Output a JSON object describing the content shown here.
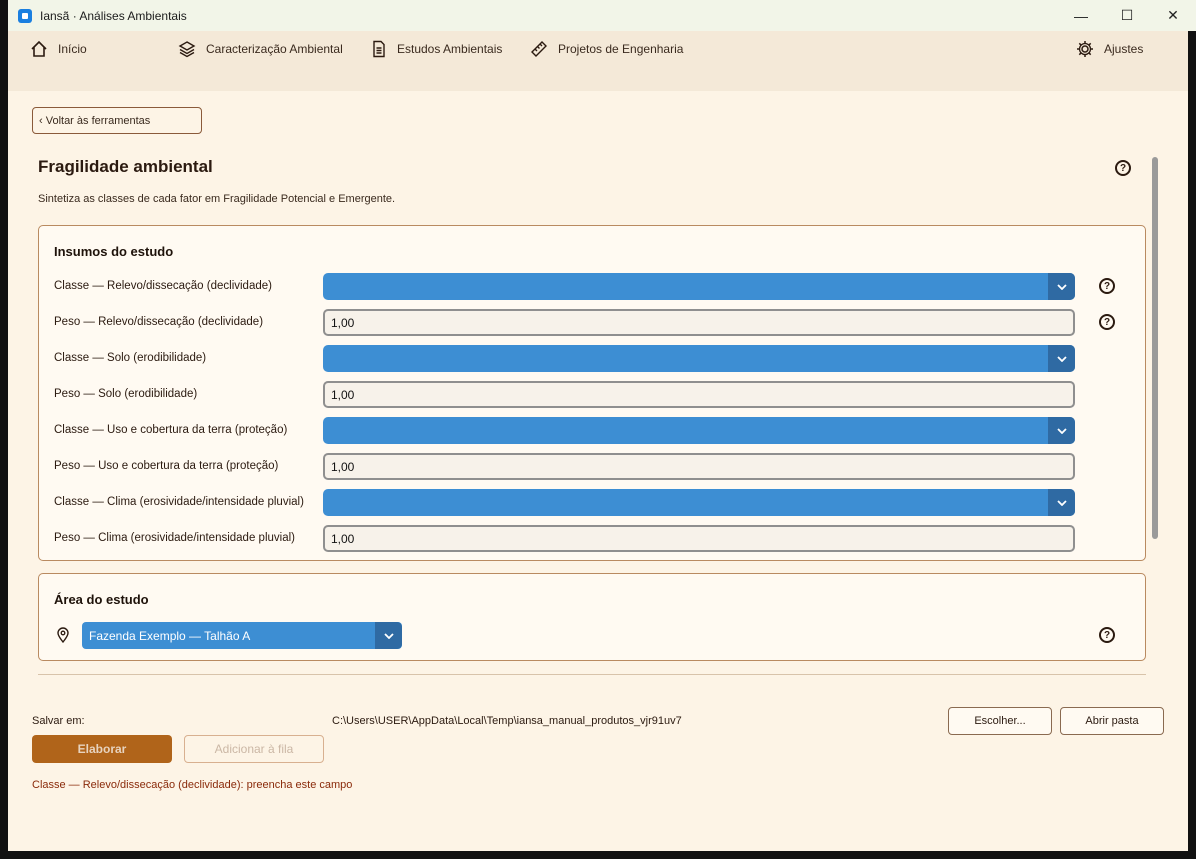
{
  "window": {
    "title": "Iansã · Análises Ambientais",
    "minimize": "—",
    "maximize": "☐",
    "close": "✕"
  },
  "nav": {
    "home": "Início",
    "characterization": "Caracterização Ambiental",
    "studies": "Estudos Ambientais",
    "engineering": "Projetos de Engenharia",
    "settings": "Ajustes"
  },
  "back_button": "‹ Voltar às ferramentas",
  "page": {
    "title": "Fragilidade ambiental",
    "subtitle": "Sintetiza as classes de cada fator em Fragilidade Potencial e Emergente.",
    "help": "?"
  },
  "inputs_card": {
    "title": "Insumos do estudo",
    "rows": [
      {
        "label": "Classe — Relevo/dissecação (declividade)",
        "type": "dropdown",
        "value": ""
      },
      {
        "label": "Peso — Relevo/dissecação (declividade)",
        "type": "text",
        "value": "1,00"
      },
      {
        "label": "Classe — Solo (erodibilidade)",
        "type": "dropdown",
        "value": ""
      },
      {
        "label": "Peso — Solo (erodibilidade)",
        "type": "text",
        "value": "1,00"
      },
      {
        "label": "Classe — Uso e cobertura da terra (proteção)",
        "type": "dropdown",
        "value": ""
      },
      {
        "label": "Peso — Uso e cobertura da terra (proteção)",
        "type": "text",
        "value": "1,00"
      },
      {
        "label": "Classe — Clima (erosividade/intensidade pluvial)",
        "type": "dropdown",
        "value": ""
      },
      {
        "label": "Peso — Clima (erosividade/intensidade pluvial)",
        "type": "text",
        "value": "1,00"
      }
    ]
  },
  "area_card": {
    "title": "Área do estudo",
    "selected": "Fazenda Exemplo — Talhão A"
  },
  "footer": {
    "save_label": "Salvar em:",
    "save_path": "C:\\Users\\USER\\AppData\\Local\\Temp\\iansa_manual_produtos_vjr91uv7",
    "choose": "Escolher...",
    "open_folder": "Abrir pasta",
    "elaborate": "Elaborar",
    "add_queue": "Adicionar à fila",
    "error": "Classe — Relevo/dissecação (declividade): preencha este campo"
  },
  "colors": {
    "accent": "#3d8ed3",
    "primary_button": "#b0641a",
    "background": "#fdf4e6",
    "nav": "#f4e9d8"
  }
}
